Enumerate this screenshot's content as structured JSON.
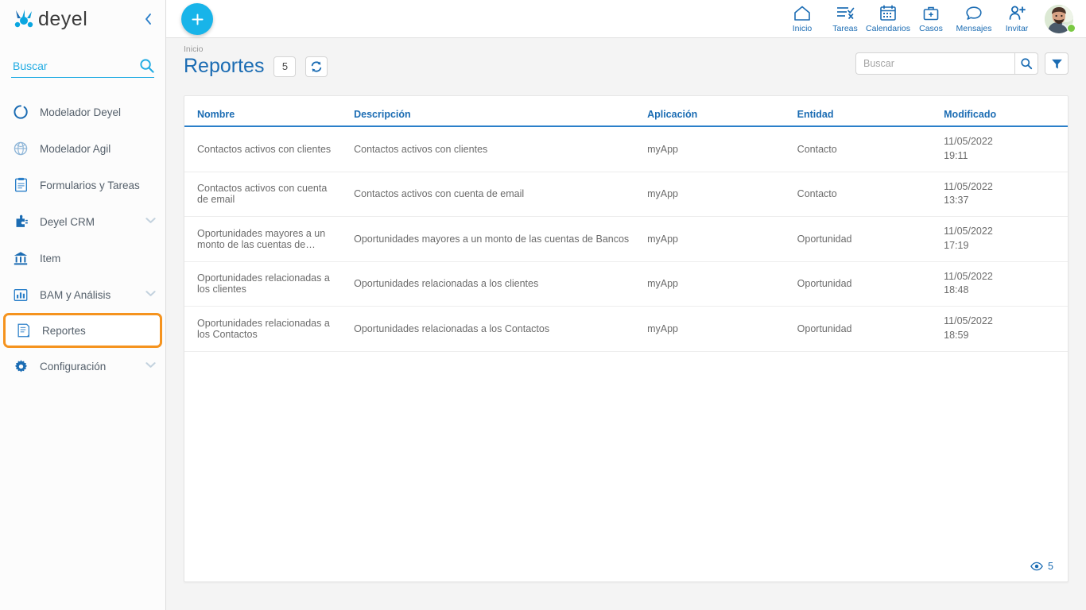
{
  "brand": {
    "name": "deyel",
    "logo_icon": "deyel-logo-mark"
  },
  "sidebar": {
    "collapse_icon": "chevron-left-icon",
    "search": {
      "placeholder": "Buscar",
      "value": "",
      "icon": "search-icon"
    },
    "items": [
      {
        "label": "Modelador Deyel",
        "icon": "circle-ring-icon",
        "expandable": false,
        "selected": false
      },
      {
        "label": "Modelador Agil",
        "icon": "globe-icon",
        "expandable": false,
        "selected": false
      },
      {
        "label": "Formularios y Tareas",
        "icon": "clipboard-icon",
        "expandable": false,
        "selected": false
      },
      {
        "label": "Deyel CRM",
        "icon": "puzzle-plug-icon",
        "expandable": true,
        "selected": false
      },
      {
        "label": "Item",
        "icon": "bank-icon",
        "expandable": false,
        "selected": false
      },
      {
        "label": "BAM y Análisis",
        "icon": "bar-chart-icon",
        "expandable": true,
        "selected": false
      },
      {
        "label": "Reportes",
        "icon": "report-page-icon",
        "expandable": false,
        "selected": true
      },
      {
        "label": "Configuración",
        "icon": "gear-icon",
        "expandable": true,
        "selected": false
      }
    ],
    "highlight_color": "#f5931e"
  },
  "topbar": {
    "create_button": {
      "label": "+",
      "icon": "plus-icon",
      "color": "#18b4e9"
    },
    "actions": [
      {
        "label": "Inicio",
        "icon": "home-icon"
      },
      {
        "label": "Tareas",
        "icon": "task-list-icon"
      },
      {
        "label": "Calendarios",
        "icon": "calendar-icon"
      },
      {
        "label": "Casos",
        "icon": "briefcase-icon"
      },
      {
        "label": "Mensajes",
        "icon": "chat-bubble-icon"
      },
      {
        "label": "Invitar",
        "icon": "user-add-icon"
      }
    ],
    "avatar": {
      "icon": "user-avatar",
      "status": "online",
      "status_color": "#7ac943"
    }
  },
  "page": {
    "breadcrumb": "Inicio",
    "title": "Reportes",
    "count_badge": "5",
    "refresh_icon": "refresh-icon",
    "search": {
      "placeholder": "Buscar",
      "value": "",
      "icon": "search-icon"
    },
    "filter_icon": "filter-funnel-icon",
    "footer": {
      "visible_count": "5",
      "icon": "eye-icon"
    }
  },
  "table": {
    "columns": [
      "Nombre",
      "Descripción",
      "Aplicación",
      "Entidad",
      "Modificado"
    ],
    "rows": [
      {
        "nombre": "Contactos activos con clientes",
        "descripcion": "Contactos activos con clientes",
        "aplicacion": "myApp",
        "entidad": "Contacto",
        "fecha": "11/05/2022",
        "hora": "19:11"
      },
      {
        "nombre": "Contactos activos con cuenta de email",
        "descripcion": "Contactos activos con cuenta de email",
        "aplicacion": "myApp",
        "entidad": "Contacto",
        "fecha": "11/05/2022",
        "hora": "13:37"
      },
      {
        "nombre": "Oportunidades mayores a un monto de las cuentas de…",
        "descripcion": "Oportunidades mayores a un monto de las cuentas de Bancos",
        "aplicacion": "myApp",
        "entidad": "Oportunidad",
        "fecha": "11/05/2022",
        "hora": "17:19"
      },
      {
        "nombre": "Oportunidades relacionadas a los clientes",
        "descripcion": "Oportunidades relacionadas a los clientes",
        "aplicacion": "myApp",
        "entidad": "Oportunidad",
        "fecha": "11/05/2022",
        "hora": "18:48"
      },
      {
        "nombre": "Oportunidades relacionadas a los Contactos",
        "descripcion": "Oportunidades relacionadas a los Contactos",
        "aplicacion": "myApp",
        "entidad": "Oportunidad",
        "fecha": "11/05/2022",
        "hora": "18:59"
      }
    ]
  },
  "colors": {
    "primary": "#1b6cb3",
    "accent_cyan": "#22ace3",
    "highlight_orange": "#f5931e"
  }
}
